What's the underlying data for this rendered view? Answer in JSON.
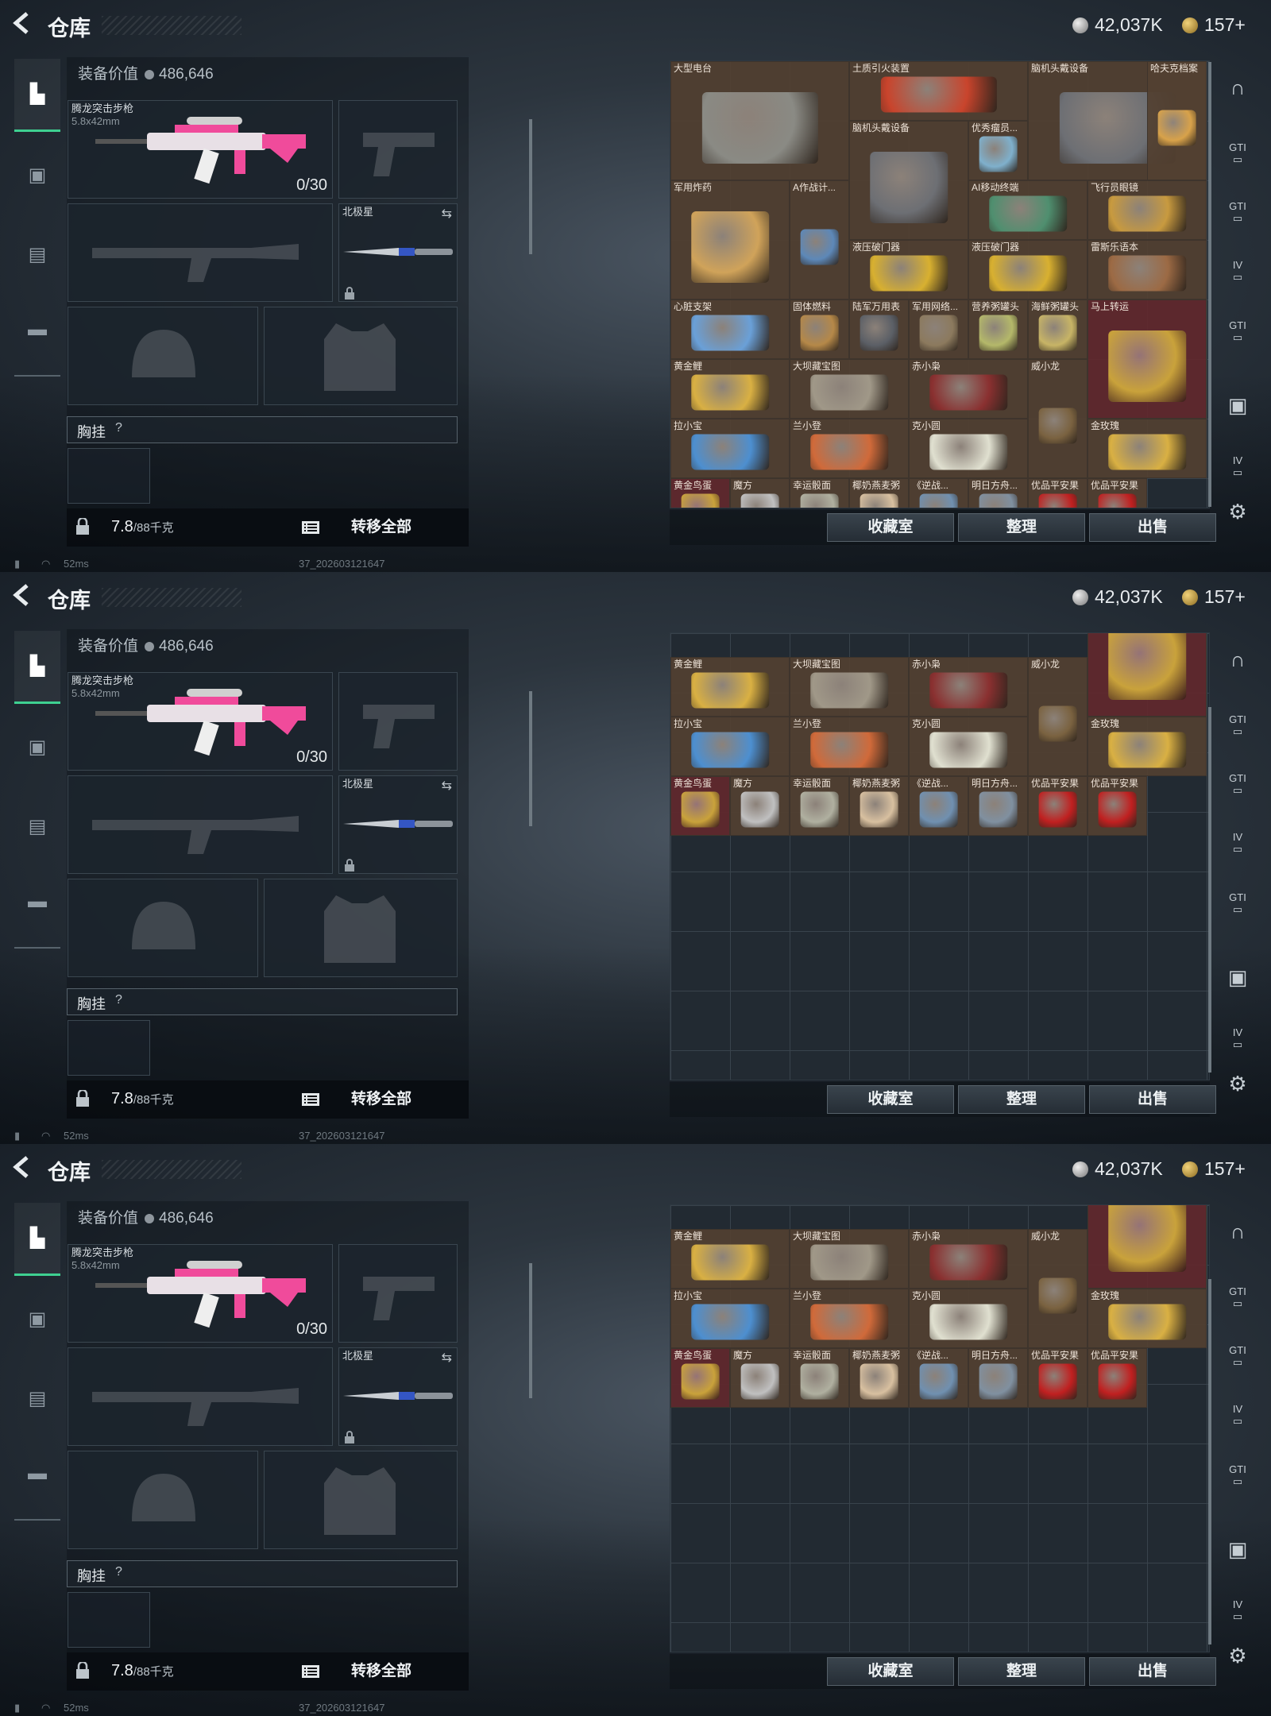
{
  "header": {
    "title": "仓库",
    "currency_coins": "42,037K",
    "currency_tickets": "157+"
  },
  "equipment": {
    "value_label": "装备价值",
    "value": "486,646",
    "rifle_name": "腾龙突击步枪",
    "rifle_caliber": "5.8x42mm",
    "rifle_ammo": "0/30",
    "knife_name": "北极星",
    "chest_label": "胸挂",
    "chest_help": "?",
    "weight_value": "7.8",
    "weight_max": "/88千克",
    "transfer_all": "转移全部"
  },
  "status": {
    "ping": "52ms",
    "build": "37_202603121647"
  },
  "actions": {
    "collection": "收藏室",
    "sort": "整理",
    "sell": "出售"
  },
  "right_nav": [
    "GTI",
    "GTI",
    "IV",
    "GTI",
    "IV"
  ],
  "items_panel1": [
    {
      "name": "大型电台",
      "color": "#8a8a84"
    },
    {
      "name": "土质引火装置",
      "color": "#c9442c"
    },
    {
      "name": "脑机头戴设备",
      "color": "#6d6f74"
    },
    {
      "name": "哈夫克档案",
      "color": "#d8a24a"
    },
    {
      "name": "脑机头戴设备",
      "color": "#6d6f74"
    },
    {
      "name": "优秀瘤员...",
      "color": "#7fb0cc"
    },
    {
      "name": "军用炸药",
      "color": "#d0a35a"
    },
    {
      "name": "A作战计...",
      "color": "#5d88b8"
    },
    {
      "name": "AI移动终端",
      "color": "#4f8f6f"
    },
    {
      "name": "飞行员眼镜",
      "color": "#c89a3f"
    },
    {
      "name": "液压破门器",
      "color": "#d8b030"
    },
    {
      "name": "液压破门器",
      "color": "#d8b030"
    },
    {
      "name": "雷斯乐语本",
      "color": "#9c6a44"
    },
    {
      "name": "心脏支架",
      "color": "#6aa0d8"
    },
    {
      "name": "固体燃料",
      "color": "#b58848"
    },
    {
      "name": "陆军万用表",
      "color": "#5b5f66"
    },
    {
      "name": "军用网络...",
      "color": "#8c7a5e"
    },
    {
      "name": "营养粥罐头",
      "color": "#b4b86a"
    },
    {
      "name": "海鲜粥罐头",
      "color": "#c7b466"
    },
    {
      "name": "马上转运",
      "color": "#c9a23b"
    },
    {
      "name": "黄金鲤",
      "color": "#d9b043"
    },
    {
      "name": "大坝藏宝图",
      "color": "#a09888"
    },
    {
      "name": "赤小枭",
      "color": "#8a3030"
    },
    {
      "name": "威小龙",
      "color": "#7a6240"
    },
    {
      "name": "拉小宝",
      "color": "#4d8fd0"
    },
    {
      "name": "兰小登",
      "color": "#d06a3a"
    },
    {
      "name": "克小圆",
      "color": "#e0e0d0"
    },
    {
      "name": "金玫瑰",
      "color": "#d9b043"
    },
    {
      "name": "黄金鸟蛋",
      "color": "#c9a23b"
    },
    {
      "name": "魔方",
      "color": "#c0c0c0"
    },
    {
      "name": "幸运骰面",
      "color": "#b0b0a0"
    },
    {
      "name": "椰奶燕麦粥",
      "color": "#d8c0a0"
    },
    {
      "name": "《逆战...",
      "color": "#7090b0"
    },
    {
      "name": "明日方舟...",
      "color": "#8090a0"
    },
    {
      "name": "优品平安果",
      "color": "#c02020"
    },
    {
      "name": "优品平安果",
      "color": "#c02020"
    }
  ]
}
